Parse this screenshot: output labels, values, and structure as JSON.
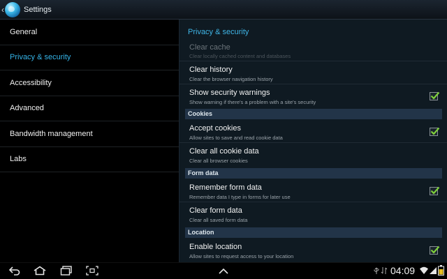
{
  "header": {
    "title": "Settings"
  },
  "sidebar": {
    "items": [
      {
        "label": "General",
        "selected": false
      },
      {
        "label": "Privacy & security",
        "selected": true
      },
      {
        "label": "Accessibility",
        "selected": false
      },
      {
        "label": "Advanced",
        "selected": false
      },
      {
        "label": "Bandwidth management",
        "selected": false
      },
      {
        "label": "Labs",
        "selected": false
      }
    ]
  },
  "main": {
    "title": "Privacy & security",
    "clear_cache": {
      "title": "Clear cache",
      "summary": "Clear locally cached content and databases",
      "enabled": false
    },
    "clear_history": {
      "title": "Clear history",
      "summary": "Clear the browser navigation history"
    },
    "security_warnings": {
      "title": "Show security warnings",
      "summary": "Show warning if there's a problem with a site's security",
      "checked": true
    },
    "cookies_header": "Cookies",
    "accept_cookies": {
      "title": "Accept cookies",
      "summary": "Allow sites to save and read cookie data",
      "checked": true
    },
    "clear_cookies": {
      "title": "Clear all cookie data",
      "summary": "Clear all browser cookies"
    },
    "form_header": "Form data",
    "remember_form": {
      "title": "Remember form data",
      "summary": "Remember data I type in forms for later use",
      "checked": true
    },
    "clear_form": {
      "title": "Clear form data",
      "summary": "Clear all saved form data"
    },
    "location_header": "Location",
    "enable_location": {
      "title": "Enable location",
      "summary": "Allow sites to request access to your location",
      "checked": true
    }
  },
  "status_bar": {
    "time": "04:09"
  },
  "colors": {
    "accent": "#35b4e8",
    "check": "#7fd13b",
    "section_bg": "#223448"
  },
  "icons": [
    "back-icon",
    "home-icon",
    "recent-apps-icon",
    "screenshot-icon",
    "menu-up-icon",
    "usb-icon",
    "wifi-icon",
    "signal-icon",
    "battery-icon"
  ]
}
